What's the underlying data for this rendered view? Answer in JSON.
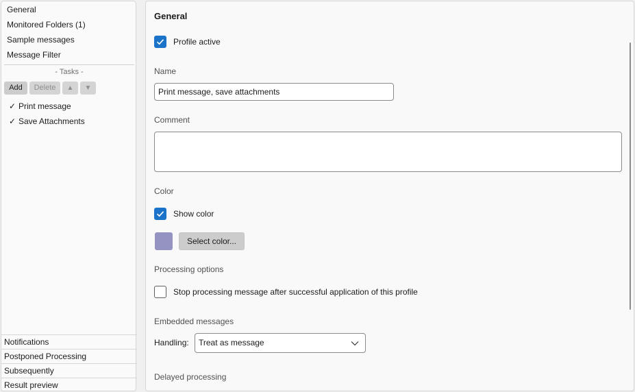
{
  "sidebar": {
    "nav": [
      {
        "label": "General"
      },
      {
        "label": "Monitored Folders (1)"
      },
      {
        "label": "Sample messages"
      },
      {
        "label": "Message Filter"
      }
    ],
    "tasks_header": "- Tasks -",
    "buttons": {
      "add": "Add",
      "delete": "Delete",
      "up": "▲",
      "down": "▼"
    },
    "tasks": [
      {
        "check": "✓",
        "label": "Print message"
      },
      {
        "check": "✓",
        "label": "Save Attachments"
      }
    ],
    "bottom": [
      {
        "label": "Notifications"
      },
      {
        "label": "Postponed Processing"
      },
      {
        "label": "Subsequently"
      },
      {
        "label": "Result preview"
      }
    ]
  },
  "main": {
    "title": "General",
    "profile_active": {
      "label": "Profile active",
      "checked": true
    },
    "name": {
      "label": "Name",
      "value": "Print message, save attachments"
    },
    "comment": {
      "label": "Comment",
      "value": ""
    },
    "color": {
      "label": "Color",
      "show_color": {
        "label": "Show color",
        "checked": true
      },
      "swatch": "#9593c2",
      "select_button": "Select color..."
    },
    "processing": {
      "label": "Processing options",
      "stop": {
        "label": "Stop processing message after successful application of this profile",
        "checked": false
      }
    },
    "embedded": {
      "label": "Embedded messages",
      "handling_label": "Handling:",
      "handling_value": "Treat as message"
    },
    "delayed": {
      "label": "Delayed processing"
    }
  },
  "colors": {
    "accent": "#1a73c9"
  }
}
